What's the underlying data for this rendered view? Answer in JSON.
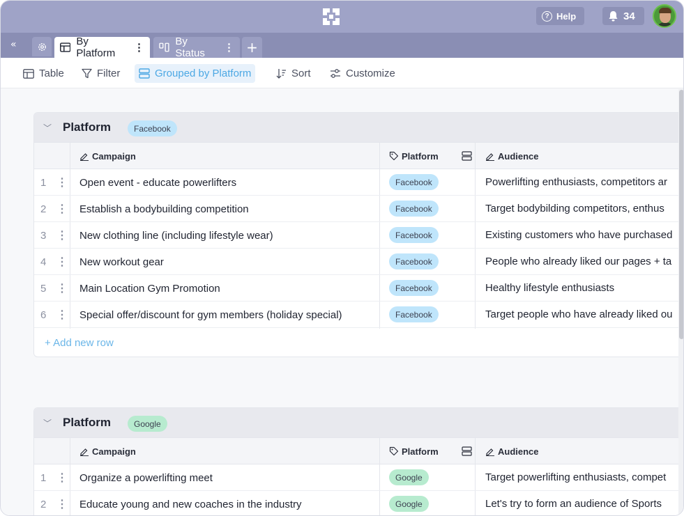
{
  "topbar": {
    "help_label": "Help",
    "notifications_count": "34"
  },
  "tabs": {
    "collapse_label": "«",
    "items": [
      {
        "label": "By Platform",
        "active": true
      },
      {
        "label": "By Status",
        "active": false
      }
    ],
    "add_label": "+"
  },
  "toolbar": {
    "table_label": "Table",
    "filter_label": "Filter",
    "grouped_label": "Grouped by Platform",
    "sort_label": "Sort",
    "customize_label": "Customize"
  },
  "columns": {
    "campaign": "Campaign",
    "platform": "Platform",
    "audience": "Audience"
  },
  "groups": [
    {
      "title": "Platform",
      "badge": "Facebook",
      "badge_color": "#bfe5fb",
      "rows": [
        {
          "num": "1",
          "campaign": "Open event - educate powerlifters",
          "platform": "Facebook",
          "audience": "Powerlifting enthusiasts, competitors ar"
        },
        {
          "num": "2",
          "campaign": "Establish a bodybuilding competition",
          "platform": "Facebook",
          "audience": "Target bodybilding competitors, enthus"
        },
        {
          "num": "3",
          "campaign": "New clothing line (including lifestyle wear)",
          "platform": "Facebook",
          "audience": "Existing customers who have purchased"
        },
        {
          "num": "4",
          "campaign": "New workout gear",
          "platform": "Facebook",
          "audience": "People who already liked our pages + ta"
        },
        {
          "num": "5",
          "campaign": "Main Location Gym Promotion",
          "platform": "Facebook",
          "audience": "Healthy lifestyle enthusiasts"
        },
        {
          "num": "6",
          "campaign": "Special offer/discount for gym members (holiday special)",
          "platform": "Facebook",
          "audience": "Target people who have already liked ou"
        }
      ],
      "add_row_label": "+ Add new row"
    },
    {
      "title": "Platform",
      "badge": "Google",
      "badge_color": "#b7ebcf",
      "rows": [
        {
          "num": "1",
          "campaign": "Organize a powerlifting meet",
          "platform": "Google",
          "audience": "Target powerlifting enthusiasts, compet"
        },
        {
          "num": "2",
          "campaign": "Educate young and new coaches in the industry",
          "platform": "Google",
          "audience": "Let's try to form an audience of Sports"
        }
      ]
    }
  ]
}
